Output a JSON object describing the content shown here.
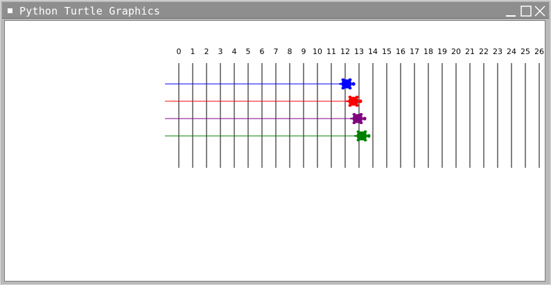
{
  "window": {
    "title": "Python Turtle Graphics"
  },
  "icons": {
    "menu": "window-menu-icon",
    "minimize": "minimize-icon",
    "maximize": "maximize-icon",
    "close": "close-icon"
  },
  "race": {
    "track_tick_labels": [
      "0",
      "1",
      "2",
      "3",
      "4",
      "5",
      "6",
      "7",
      "8",
      "9",
      "10",
      "11",
      "12",
      "13",
      "14",
      "15",
      "16",
      "17",
      "18",
      "19",
      "20",
      "21",
      "22",
      "23",
      "24",
      "25",
      "26"
    ],
    "turtles": [
      {
        "color": "#0000ff",
        "position": 12.1
      },
      {
        "color": "#ff0000",
        "position": 12.6
      },
      {
        "color": "#800080",
        "position": 12.9
      },
      {
        "color": "#008000",
        "position": 13.2
      }
    ]
  }
}
